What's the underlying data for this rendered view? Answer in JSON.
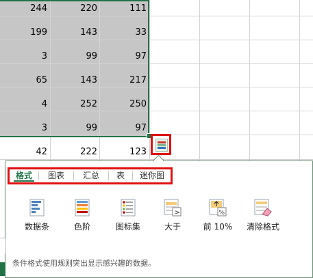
{
  "grid": {
    "rows": [
      [
        "244",
        "220",
        "111"
      ],
      [
        "199",
        "143",
        "33"
      ],
      [
        "3",
        "99",
        "97"
      ],
      [
        "65",
        "143",
        "217"
      ],
      [
        "4",
        "252",
        "250"
      ],
      [
        "3",
        "99",
        "97"
      ],
      [
        "42",
        "222",
        "123"
      ]
    ]
  },
  "quick_analysis": {
    "button_icon": "quick-analysis-icon",
    "tabs": [
      {
        "label": "格式",
        "active": true
      },
      {
        "label": "图表",
        "active": false
      },
      {
        "label": "汇总",
        "active": false
      },
      {
        "label": "表",
        "active": false
      },
      {
        "label": "迷你图",
        "active": false
      }
    ],
    "options": [
      {
        "label": "数据条",
        "icon": "data-bars-icon"
      },
      {
        "label": "色阶",
        "icon": "color-scale-icon"
      },
      {
        "label": "图标集",
        "icon": "icon-set-icon"
      },
      {
        "label": "大于",
        "icon": "greater-than-icon"
      },
      {
        "label": "前 10%",
        "icon": "top-10-percent-icon"
      },
      {
        "label": "清除格式",
        "icon": "clear-format-icon"
      }
    ],
    "description": "条件格式使用规则突出显示感兴趣的数据。"
  },
  "colors": {
    "accent": "#217346",
    "highlight_border": "#e01010",
    "selection_fill": "#c6c6c6"
  }
}
